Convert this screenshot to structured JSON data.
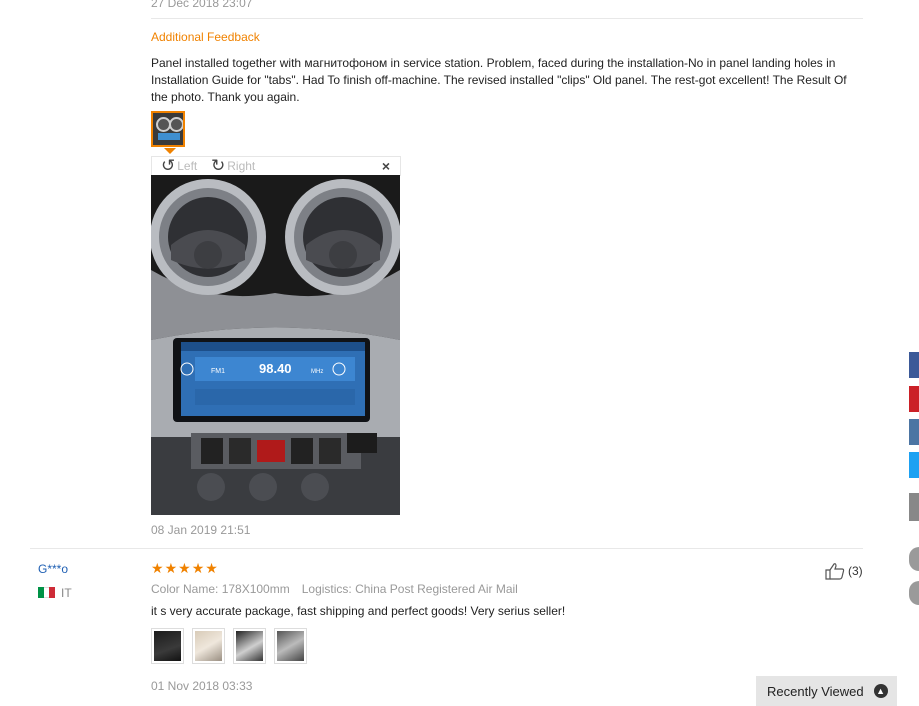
{
  "review1": {
    "prev_date": "27 Dec 2018 23:07",
    "additional_feedback_title": "Additional Feedback",
    "feedback_text": "Panel installed together with магнитофоном in service station. Problem, faced during the installation-No in panel landing holes in Installation Guide for \"tabs\". Had To finish off-machine. The revised installed \"clips\" Old panel. The rest-got excellent! The Result Of the photo. Thank you again.",
    "viewer": {
      "rotate_left_label": "Left",
      "rotate_right_label": "Right",
      "close_label": "×"
    },
    "photo_radio_display": {
      "band": "FM1",
      "frequency": "98.40",
      "unit": "MHz"
    },
    "feedback_date": "08 Jan 2019 21:51"
  },
  "review2": {
    "username": "G***o",
    "country": "IT",
    "rating": 5,
    "star_glyph": "★",
    "color_label": "Color Name: 178X100mm",
    "logistics_label": "Logistics: China Post Registered Air Mail",
    "text": "it s very accurate package, fast shipping and perfect goods! Very serius seller!",
    "helpful_count": "(3)",
    "photos": [
      "photo-1",
      "photo-2",
      "photo-3",
      "photo-4"
    ],
    "date": "01 Nov 2018 03:33"
  },
  "recently_viewed": {
    "label": "Recently Viewed",
    "icon": "chevron-up-icon"
  },
  "colors": {
    "accent": "#f08200",
    "link": "#1e5fb3",
    "facebook": "#3b5998",
    "pinterest": "#cb2027",
    "vk": "#4c75a3",
    "twitter": "#1da1f2"
  }
}
